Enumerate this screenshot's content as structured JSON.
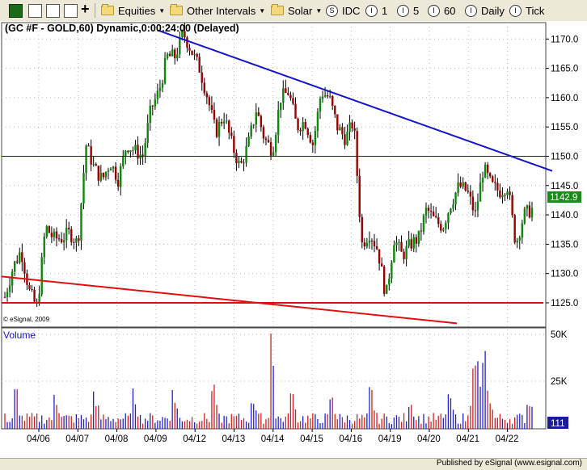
{
  "toolbar": {
    "menus": [
      "Equities",
      "Other Intervals",
      "Solar"
    ],
    "intervals": [
      {
        "badge": "S",
        "label": "IDC"
      },
      {
        "badge": "I",
        "label": "1"
      },
      {
        "badge": "I",
        "label": "5"
      },
      {
        "badge": "I",
        "label": "60"
      },
      {
        "badge": "I",
        "label": "Daily"
      },
      {
        "badge": "I",
        "label": "Tick"
      }
    ],
    "icons": [
      "chart-window-icon",
      "grid-icon",
      "copy-icon",
      "edit-icon",
      "plus-icon"
    ]
  },
  "chart": {
    "title": "(GC #F - GOLD,60) Dynamic,0:00:24:00 (Delayed)",
    "copyright": "© eSignal, 2009",
    "volume_label": "Volume",
    "last_price": "1142.9",
    "last_volume": "111",
    "colors": {
      "up": "#0a8a0a",
      "down": "#9a0000",
      "trend_up": "#1414c8",
      "trend_down": "#e01010",
      "vol_up": "#2020d0",
      "vol_down": "#d02020"
    }
  },
  "status": {
    "text": "Published by eSignal (www.esignal.com)"
  },
  "chart_data": {
    "type": "candlestick",
    "price_ticks": [
      "1170.0",
      "1165.0",
      "1160.0",
      "1155.0",
      "1150.0",
      "1145.0",
      "1140.0",
      "1135.0",
      "1130.0",
      "1125.0"
    ],
    "volume_ticks": [
      "50K",
      "25K"
    ],
    "date_labels": [
      "04/06",
      "04/07",
      "04/08",
      "04/09",
      "04/12",
      "04/13",
      "04/14",
      "04/15",
      "04/16",
      "04/19",
      "04/20",
      "04/21",
      "04/22"
    ],
    "ylim": [
      1119,
      1175
    ],
    "horizontal_lines": [
      1150.0
    ],
    "trendlines": [
      {
        "color": "blue",
        "from": [
          "04/09",
          1171.5
        ],
        "to": [
          "04/22",
          1147.5
        ]
      },
      {
        "color": "red",
        "from": [
          "04/05",
          1129.5
        ],
        "to": [
          "04/20",
          1121.5
        ]
      },
      {
        "color": "red",
        "from": [
          "04/05",
          1125.0
        ],
        "to": [
          "04/22",
          1125.0
        ]
      }
    ],
    "close_path": [
      1126,
      1131,
      1134,
      1127,
      1124,
      1138,
      1136,
      1136,
      1137,
      1135,
      1152,
      1148,
      1146,
      1149,
      1146,
      1152,
      1151,
      1150,
      1158,
      1161,
      1167,
      1167,
      1171,
      1168,
      1165,
      1160,
      1154,
      1157,
      1152,
      1148,
      1152,
      1158,
      1153,
      1151,
      1160,
      1161,
      1155,
      1156,
      1152,
      1161,
      1160,
      1155,
      1153,
      1156,
      1135,
      1137,
      1134,
      1126,
      1136,
      1133,
      1135,
      1136,
      1141,
      1139,
      1138,
      1142,
      1145,
      1144,
      1140,
      1148,
      1145,
      1144,
      1145,
      1135,
      1140,
      1141
    ]
  }
}
